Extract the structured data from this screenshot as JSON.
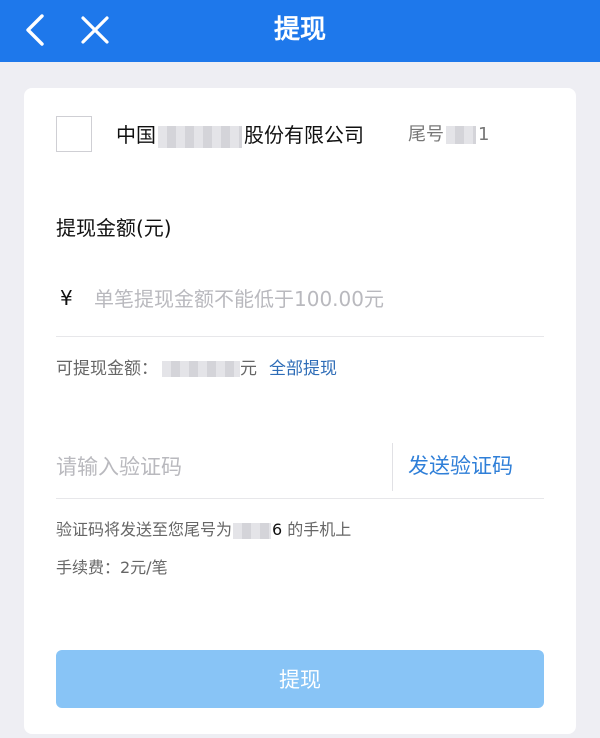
{
  "nav": {
    "title": "提现",
    "back_icon": "chevron-left-icon",
    "close_icon": "close-icon",
    "background": "#1e78eb"
  },
  "bank": {
    "name_prefix": "中国",
    "name_suffix": "股份有限公司",
    "tail_label": "尾号",
    "tail_digit": "1"
  },
  "amount": {
    "label": "提现金额(元)",
    "currency_symbol": "¥",
    "placeholder": "单笔提现金额不能低于100.00元",
    "value": ""
  },
  "available": {
    "label": "可提现金额：",
    "unit": "元",
    "withdraw_all": "全部提现"
  },
  "verification": {
    "placeholder": "请输入验证码",
    "value": "",
    "send_button": "发送验证码"
  },
  "notice": {
    "prefix": "验证码将发送至您尾号为",
    "digit": "6",
    "suffix": " 的手机上"
  },
  "fee": {
    "text": "手续费：2元/笔"
  },
  "submit": {
    "label": "提现",
    "color": "#88c4f6"
  }
}
